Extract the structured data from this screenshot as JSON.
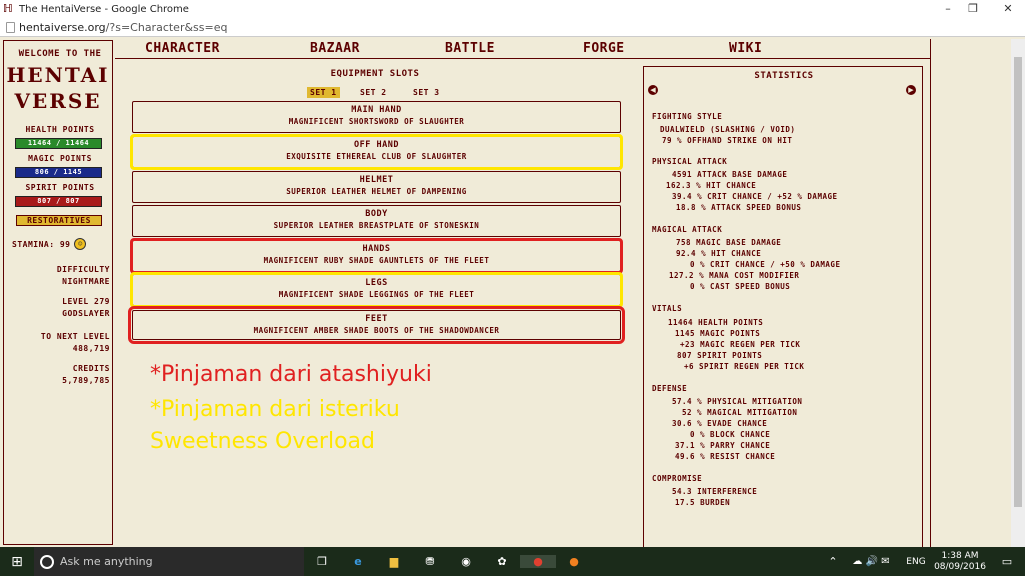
{
  "browser": {
    "title": "The HentaiVerse - Google Chrome",
    "url_host": "hentaiverse.org",
    "url_rest": "/?s=Character&ss=eq",
    "minimize": "–",
    "maximize": "❐",
    "close": "✕"
  },
  "left": {
    "welcome": "Welcome to the",
    "brand1": "Hentai",
    "brand2": "Verse",
    "health_label": "Health points",
    "health_value": "11464 / 11464",
    "magic_label": "Magic points",
    "magic_value": "806 / 1145",
    "spirit_label": "Spirit points",
    "spirit_value": "807 / 807",
    "restoratives": "Restoratives",
    "stamina": "Stamina: 99",
    "difficulty_label": "Difficulty",
    "difficulty_value": "Nightmare",
    "level": "Level 279",
    "title": "Godslayer",
    "next_level_label": "To next level",
    "next_level_value": "488,719",
    "credits_label": "Credits",
    "credits_value": "5,789,785"
  },
  "nav": [
    "Character",
    "Bazaar",
    "Battle",
    "Forge",
    "Wiki"
  ],
  "equipment": {
    "title": "Equipment slots",
    "sets": [
      "Set 1",
      "Set 2",
      "Set 3"
    ],
    "slots": [
      {
        "name": "Main Hand",
        "item": "Magnificent Shortsword of Slaughter"
      },
      {
        "name": "Off Hand",
        "item": "Exquisite Ethereal Club of Slaughter"
      },
      {
        "name": "Helmet",
        "item": "Superior Leather Helmet of Dampening"
      },
      {
        "name": "Body",
        "item": "Superior Leather Breastplate of Stoneskin"
      },
      {
        "name": "Hands",
        "item": "Magnificent Ruby Shade Gauntlets of the Fleet"
      },
      {
        "name": "Legs",
        "item": "Magnificent Shade Leggings of the Fleet"
      },
      {
        "name": "Feet",
        "item": "Magnificent Amber Shade Boots of the Shadowdancer"
      }
    ]
  },
  "notes": {
    "red": "*Pinjaman dari atashiyuki",
    "yellow1": "*Pinjaman dari isteriku",
    "yellow2": "Sweetness Overload"
  },
  "stats": {
    "title": "Statistics",
    "fighting_style": {
      "header": "Fighting Style",
      "line1": "Dualwield (Slashing / Void)",
      "line2": "79 % offhand strike on hit"
    },
    "physical": {
      "header": "Physical Attack",
      "rows": [
        {
          "v": "4591",
          "t": "attack base damage"
        },
        {
          "v": "162.3",
          "t": "% hit chance"
        },
        {
          "v": "39.4",
          "t": "% crit chance / +52 % damage"
        },
        {
          "v": "18.8",
          "t": "% attack speed bonus"
        }
      ]
    },
    "magical": {
      "header": "Magical Attack",
      "rows": [
        {
          "v": "758",
          "t": "magic base damage"
        },
        {
          "v": "92.4",
          "t": "% hit chance"
        },
        {
          "v": "0",
          "t": "% crit chance / +50 % damage"
        },
        {
          "v": "127.2",
          "t": "% mana cost modifier"
        },
        {
          "v": "0",
          "t": "% cast speed bonus"
        }
      ]
    },
    "vitals": {
      "header": "Vitals",
      "rows": [
        {
          "v": "11464",
          "t": "health points"
        },
        {
          "v": "1145",
          "t": "magic points"
        },
        {
          "v": "+23",
          "t": "magic regen per tick"
        },
        {
          "v": "807",
          "t": "spirit points"
        },
        {
          "v": "+6",
          "t": "spirit regen per tick"
        }
      ]
    },
    "defense": {
      "header": "Defense",
      "rows": [
        {
          "v": "57.4",
          "t": "% physical mitigation"
        },
        {
          "v": "52",
          "t": "% magical mitigation"
        },
        {
          "v": "30.6",
          "t": "% evade chance"
        },
        {
          "v": "0",
          "t": "% block chance"
        },
        {
          "v": "37.1",
          "t": "% parry chance"
        },
        {
          "v": "49.6",
          "t": "% resist chance"
        }
      ]
    },
    "compromise": {
      "header": "Compromise",
      "rows": [
        {
          "v": "54.3",
          "t": "interference"
        },
        {
          "v": "17.5",
          "t": "burden"
        }
      ]
    }
  },
  "taskbar": {
    "search_placeholder": "Ask me anything",
    "lang": "ENG",
    "time": "1:38 AM",
    "date": "08/09/2016"
  },
  "colors": {
    "accent": "#5c0000",
    "background": "#f0ebd8",
    "highlight": "#e0b830",
    "outline_red": "#e02020",
    "outline_yellow": "#ffe600"
  }
}
